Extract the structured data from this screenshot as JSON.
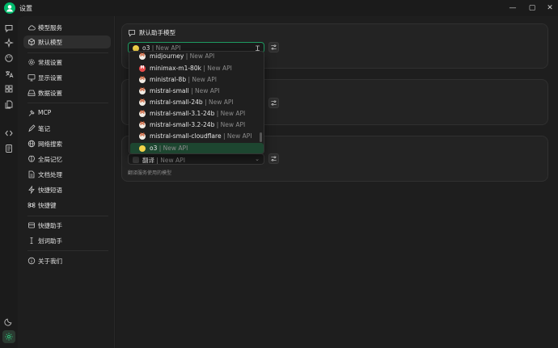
{
  "window": {
    "title": "设置",
    "minimize": "—",
    "maximize": "▢",
    "close": "✕"
  },
  "iconbar": {
    "icons": [
      "chat-icon",
      "sparkle-icon",
      "palette-icon",
      "translate-icon",
      "apps-icon",
      "files-icon",
      "code-icon",
      "notes-icon",
      "theme-icon",
      "settings-icon"
    ]
  },
  "sidebar": {
    "items": [
      {
        "label": "模型服务",
        "icon": "cloud-icon"
      },
      {
        "label": "默认模型",
        "icon": "cube-icon"
      },
      {
        "label": "常规设置",
        "icon": "gear-icon"
      },
      {
        "label": "显示设置",
        "icon": "monitor-icon"
      },
      {
        "label": "数据设置",
        "icon": "hard-drive-icon"
      },
      {
        "label": "MCP",
        "icon": "hammer-icon"
      },
      {
        "label": "笔记",
        "icon": "notebook-icon"
      },
      {
        "label": "网络搜索",
        "icon": "globe-icon"
      },
      {
        "label": "全局记忆",
        "icon": "brain-icon"
      },
      {
        "label": "文档处理",
        "icon": "document-icon"
      },
      {
        "label": "快捷短语",
        "icon": "zap-icon"
      },
      {
        "label": "快捷键",
        "icon": "command-icon"
      },
      {
        "label": "快捷助手",
        "icon": "package-icon"
      },
      {
        "label": "划词助手",
        "icon": "text-cursor-icon"
      },
      {
        "label": "关于我们",
        "icon": "info-icon"
      }
    ],
    "active": "默认模型"
  },
  "main": {
    "card1": {
      "title": "默认助手模型",
      "select": {
        "model": "o3",
        "separator": " | ",
        "provider": "New API"
      }
    },
    "card3": {
      "select": {
        "model": "翻译",
        "separator": " | ",
        "provider": "New API"
      },
      "hint": "翻译服务使用的模型"
    }
  },
  "dropdown": {
    "options": [
      {
        "model": "midjourney",
        "provider": "New API"
      },
      {
        "model": "minimax-m1-80k",
        "provider": "New API"
      },
      {
        "model": "ministral-8b",
        "provider": "New API"
      },
      {
        "model": "mistral-small",
        "provider": "New API"
      },
      {
        "model": "mistral-small-24b",
        "provider": "New API"
      },
      {
        "model": "mistral-small-3.1-24b",
        "provider": "New API"
      },
      {
        "model": "mistral-small-3.2-24b",
        "provider": "New API"
      },
      {
        "model": "mistral-small-cloudflare",
        "provider": "New API"
      },
      {
        "model": "o3",
        "provider": "New API"
      }
    ],
    "selected": "o3",
    "separator": " | "
  },
  "colors": {
    "accent": "#00b96b",
    "selected_bg": "#1d4630",
    "focus_border": "#1e9a60"
  }
}
